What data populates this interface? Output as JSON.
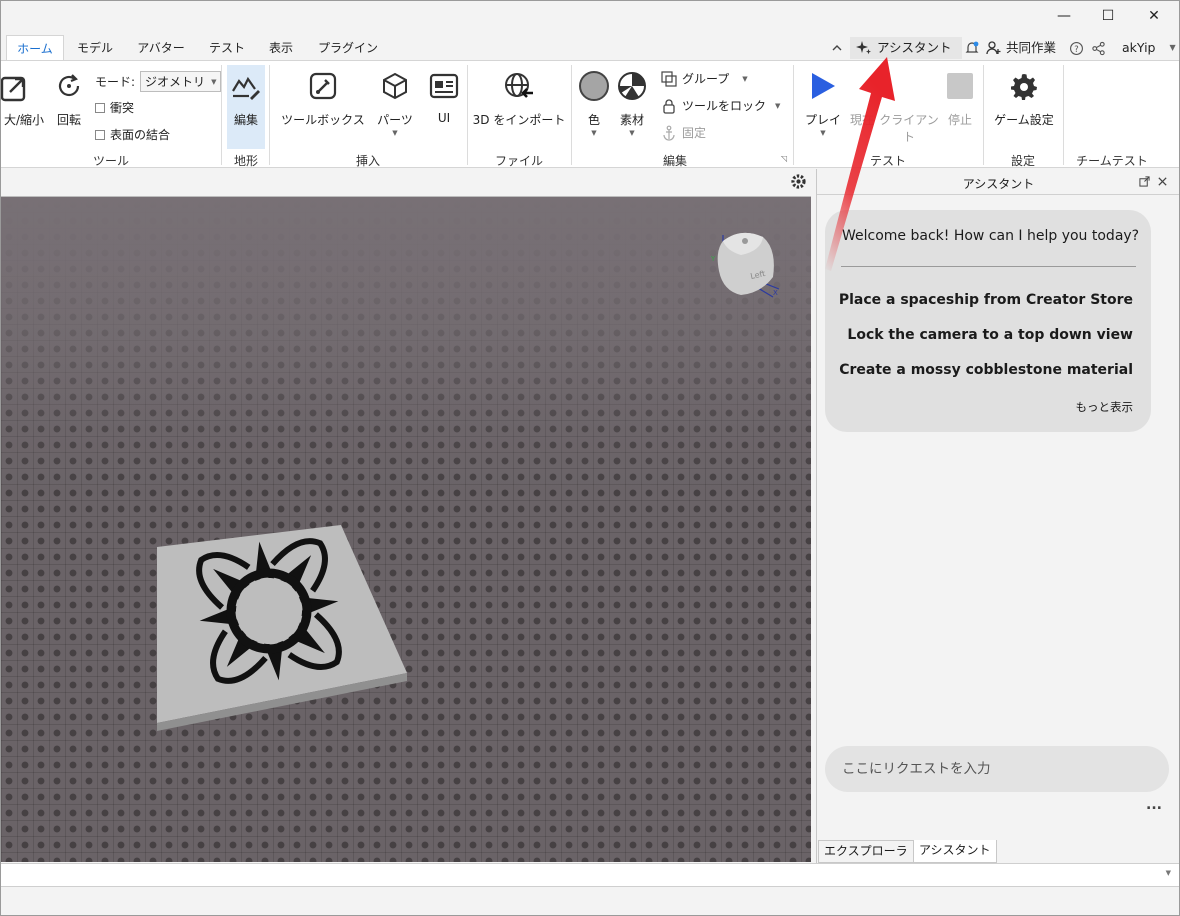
{
  "window": {
    "minimize": "—",
    "maximize": "☐",
    "close": "✕"
  },
  "tabs": [
    {
      "label": "ホーム",
      "active": true
    },
    {
      "label": "モデル"
    },
    {
      "label": "アバター"
    },
    {
      "label": "テスト"
    },
    {
      "label": "表示"
    },
    {
      "label": "プラグイン"
    }
  ],
  "topright": {
    "assistant": "アシスタント",
    "collab": "共同作業",
    "user": "akYip"
  },
  "ribbon": {
    "scale": "大/縮小",
    "rotate": "回転",
    "mode_label": "モード:",
    "mode_value": "ジオメトリ",
    "collision": "衝突",
    "surface_join": "表面の結合",
    "tools_group": "ツール",
    "terrain_edit": "編集",
    "terrain_group": "地形",
    "toolbox": "ツールボックス",
    "parts": "パーツ",
    "ui": "UI",
    "insert_group": "挿入",
    "import3d": "3D をインポート",
    "file_group": "ファイル",
    "color": "色",
    "material": "素材",
    "group": "グループ",
    "lock_tool": "ツールをロック",
    "anchor": "固定",
    "edit_group": "編集",
    "play": "プレイ",
    "current": "現在",
    "client_line1": "クライアン",
    "client_line2": "ト",
    "stop": "停止",
    "test_group": "テスト",
    "game_settings": "ゲーム設定",
    "settings_group": "設定",
    "team_test_group": "チームテスト"
  },
  "assistant_panel": {
    "title": "アシスタント",
    "welcome": "Welcome back! How can I help you today?",
    "suggestions": [
      "Place a spaceship from Creator Store",
      "Lock the camera to a top down view",
      "Create a mossy cobblestone material"
    ],
    "more": "もっと表示",
    "input_placeholder": "ここにリクエストを入力",
    "more_dots": "..."
  },
  "bottom_tabs": [
    {
      "label": "エクスプローラ"
    },
    {
      "label": "アシスタント",
      "active": true
    }
  ],
  "viewcube_label": "Left",
  "colors": {
    "accent": "#1a6fcf",
    "play": "#2a5fe0",
    "annotation_arrow": "#e8232a"
  }
}
